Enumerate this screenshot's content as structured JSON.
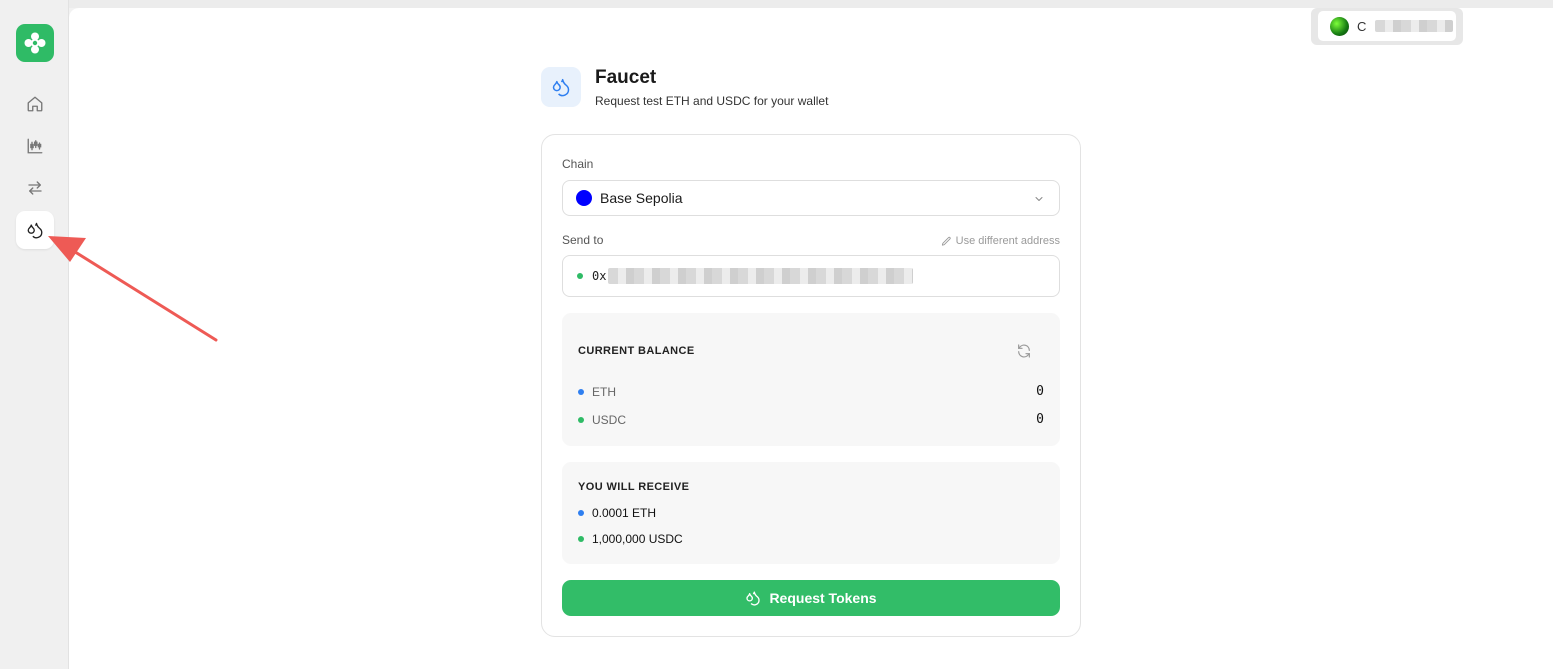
{
  "wallet": {
    "label_prefix": "C",
    "avatar_icon": "wallet-avatar-icon"
  },
  "sidebar": {
    "logo_icon": "app-logo-icon",
    "items": [
      {
        "name": "home",
        "icon": "home-icon",
        "active": false
      },
      {
        "name": "markets",
        "icon": "chart-candles-icon",
        "active": false
      },
      {
        "name": "swap",
        "icon": "swap-arrows-icon",
        "active": false
      },
      {
        "name": "faucet",
        "icon": "droplets-icon",
        "active": true
      }
    ]
  },
  "header": {
    "title": "Faucet",
    "subtitle": "Request test ETH and USDC for your wallet"
  },
  "form": {
    "chain_label": "Chain",
    "chain_value": "Base Sepolia",
    "send_to_label": "Send to",
    "alt_address_link": "Use different address",
    "address_prefix": "0x"
  },
  "balance": {
    "title": "CURRENT BALANCE",
    "rows": [
      {
        "token": "ETH",
        "value": "0"
      },
      {
        "token": "USDC",
        "value": "0"
      }
    ]
  },
  "receive": {
    "title": "YOU WILL RECEIVE",
    "rows": [
      {
        "amount": "0.0001 ETH"
      },
      {
        "amount": "1,000,000 USDC"
      }
    ]
  },
  "button": {
    "label": "Request Tokens"
  },
  "colors": {
    "accent_green": "#32bd68",
    "chain_blue": "#0000ff",
    "eth_dot": "#2f7ff0",
    "usdc_dot": "#2fbb66",
    "annotation_arrow": "#ee5a55"
  }
}
